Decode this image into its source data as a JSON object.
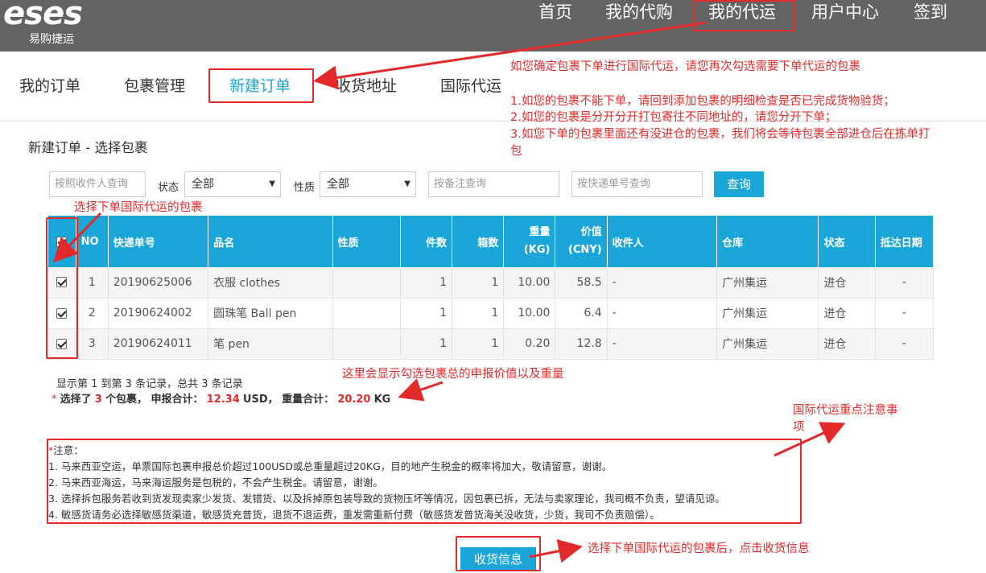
{
  "header": {
    "logo_text": "eses",
    "logo_sub": "易购捷运",
    "nav": [
      "首页",
      "我的代购",
      "我的代运",
      "用户中心",
      "签到"
    ]
  },
  "subnav": {
    "items": [
      "我的订单",
      "包裹管理",
      "新建订单",
      "收货地址",
      "国际代运"
    ]
  },
  "page_title": "新建订单 - 选择包裹",
  "filters": {
    "recipient_placeholder": "按照收件人查询",
    "status_label": "状态",
    "status_value": "全部",
    "nature_label": "性质",
    "nature_value": "全部",
    "remark_placeholder": "按备注查询",
    "tracking_placeholder": "按快递单号查询",
    "query_button": "查询"
  },
  "table": {
    "headers": [
      "NO",
      "快递单号",
      "品名",
      "性质",
      "件数",
      "箱数",
      "重量\n(KG)",
      "价值\n(CNY)",
      "收件人",
      "仓库",
      "状态",
      "抵达日期"
    ],
    "rows": [
      {
        "no": "1",
        "tracking": "20190625006",
        "name": "衣服 clothes",
        "nature": "",
        "pieces": "1",
        "boxes": "1",
        "weight": "10.00",
        "value": "58.5",
        "recipient": "-",
        "warehouse": "广州集运",
        "status": "进仓",
        "arrival": "-"
      },
      {
        "no": "2",
        "tracking": "20190624002",
        "name": "圆珠笔 Ball pen",
        "nature": "",
        "pieces": "1",
        "boxes": "1",
        "weight": "10.00",
        "value": "6.4",
        "recipient": "-",
        "warehouse": "广州集运",
        "status": "进仓",
        "arrival": "-"
      },
      {
        "no": "3",
        "tracking": "20190624011",
        "name": "笔 pen",
        "nature": "",
        "pieces": "1",
        "boxes": "1",
        "weight": "0.20",
        "value": "12.8",
        "recipient": "-",
        "warehouse": "广州集运",
        "status": "进仓",
        "arrival": "-"
      }
    ]
  },
  "summary": {
    "records": "显示第 1 到第 3 条记录，总共 3 条记录",
    "star": "*",
    "selected_prefix": "选择了",
    "selected_count": "3",
    "selected_mid": "个包裹， 申报合计：",
    "declared_total": "12.34",
    "declared_unit": "USD， 重量合计：",
    "weight_total": "20.20",
    "weight_unit": "KG"
  },
  "notes": {
    "star": "*",
    "title": "注意：",
    "items": [
      "1. 马来西亚空运，单票国际包裹申报总价超过100USD或总重量超过20KG，目的地产生税金的概率将加大，敬请留意，谢谢。",
      "2. 马来西亚海运，马来海运服务是包税的，不会产生税金。请留意，谢谢。",
      "3. 选择拆包服务若收到货发现卖家少发货、发错货、以及拆掉原包装导致的货物压坏等情况，因包裹已拆，无法与卖家理论，我司概不负责，望请见谅。",
      "4. 敏感货请务必选择敏感货渠道，敏感货充普货，退货不退运费，重发需重新付费（敏感货发普货海关没收货，少货，我司不负责赔偿）。"
    ]
  },
  "receive_button": "收货信息",
  "annotations": {
    "main1": "如您确定包裹下单进行国际代运，请您再次勾选需要下单代运的包裹",
    "main2": "1.如您的包裹不能下单，请回到添加包裹的明细检查是否已完成货物验货；",
    "main3": "2.如您的包裹是分开分开打包寄往不同地址的，请您分开下单；",
    "main4a": "3.如您下单的包裹里面还有没进仓的包裹，我们将会等待包裹全部进仓后在拣单打",
    "main4b": "包",
    "select": "选择下单国际代运的包裹",
    "total": "这里会显示勾选包裹总的申报价值以及重量",
    "notice_a": "国际代运重点注意事",
    "notice_b": "项",
    "click": "选择下单国际代运的包裹后，点击收货信息"
  },
  "colors": {
    "accent": "#1aa6d8",
    "annotation": "#e32a2a",
    "header_bg": "#636363"
  }
}
